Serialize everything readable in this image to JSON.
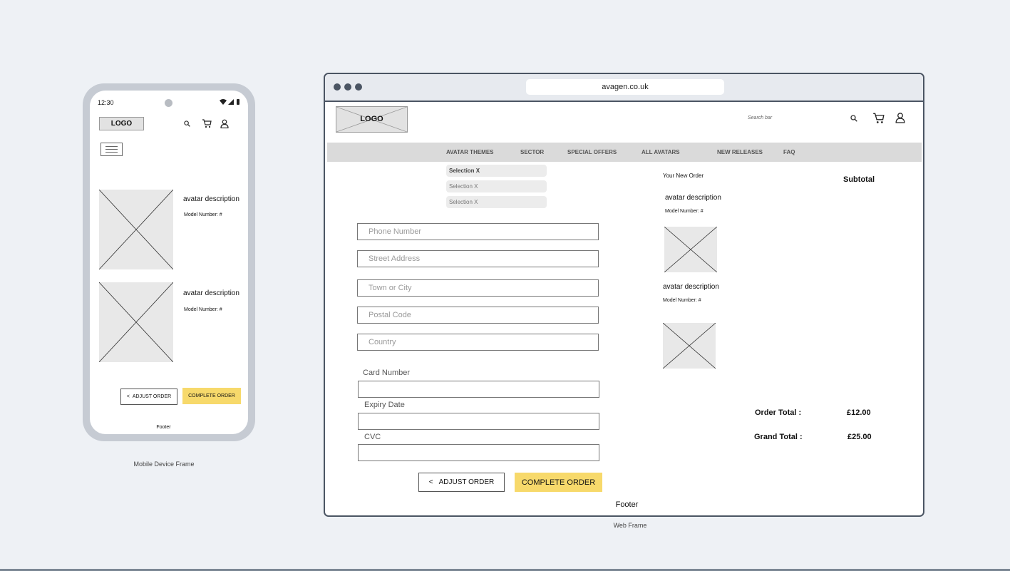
{
  "mobile": {
    "time": "12:30",
    "logo": "LOGO",
    "items": [
      {
        "description": "avatar description",
        "model": "Model Number: #"
      },
      {
        "description": "avatar description",
        "model": "Model Number: #"
      }
    ],
    "adjust_chevron": "<",
    "adjust_label": "ADJUST ORDER",
    "complete_label": "COMPLETE ORDER",
    "footer": "Footer",
    "caption": "Mobile Device Frame"
  },
  "web": {
    "url": "avagen.co.uk",
    "logo": "LOGO",
    "search_placeholder": "Search bar",
    "nav": [
      "AVATAR THEMES",
      "SECTOR",
      "SPECIAL OFFERS",
      "ALL AVATARS",
      "NEW RELEASES",
      "FAQ"
    ],
    "dropdown": [
      "Selection X",
      "Selection X",
      "Selection X"
    ],
    "fields": [
      "Phone Number",
      "Street Address",
      "Town or City",
      "Postal Code",
      "Country"
    ],
    "card_fields": [
      "Card Number",
      "Expiry Date",
      "CVC"
    ],
    "adjust_chevron": "<",
    "adjust_label": "ADJUST ORDER",
    "complete_label": "COMPLETE ORDER",
    "footer": "Footer",
    "order": {
      "heading": "Your New Order",
      "subtotal_label": "Subtotal",
      "items": [
        {
          "description": "avatar description",
          "model": "Model Number: #"
        },
        {
          "description": "avatar description",
          "model": "Model Number: #"
        }
      ],
      "order_total_label": "Order Total :",
      "order_total_value": "£12.00",
      "grand_total_label": "Grand Total :",
      "grand_total_value": "£25.00"
    },
    "caption": "Web Frame"
  },
  "colors": {
    "background": "#eef1f5",
    "frame": "#4b5563",
    "accent_button": "#f7d96b",
    "nav_bar": "#dadada",
    "placeholder": "#e8e8e8"
  },
  "icons": [
    "search-icon",
    "cart-icon",
    "user-icon",
    "menu-icon",
    "wifi-icon",
    "signal-icon",
    "battery-icon"
  ]
}
